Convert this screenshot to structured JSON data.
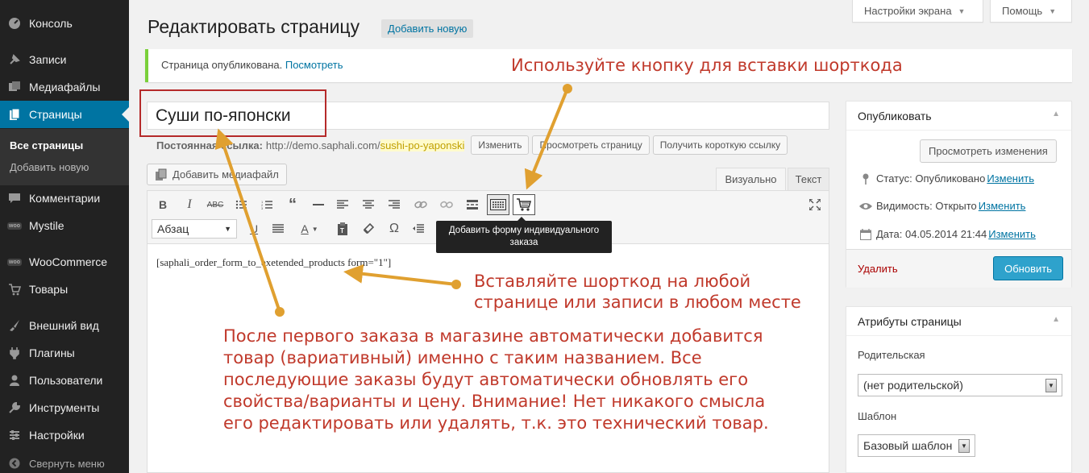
{
  "sidebar": {
    "items": [
      {
        "label": "Консоль",
        "icon": "dashboard-icon"
      },
      {
        "label": "Записи",
        "icon": "pin-icon"
      },
      {
        "label": "Медиафайлы",
        "icon": "media-icon"
      },
      {
        "label": "Страницы",
        "icon": "pages-icon"
      },
      {
        "label": "Комментарии",
        "icon": "comments-icon"
      },
      {
        "label": "Mystile",
        "icon": "woo-icon"
      },
      {
        "label": "WooCommerce",
        "icon": "woo-icon"
      },
      {
        "label": "Товары",
        "icon": "cart-icon"
      },
      {
        "label": "Внешний вид",
        "icon": "brush-icon"
      },
      {
        "label": "Плагины",
        "icon": "plugin-icon"
      },
      {
        "label": "Пользователи",
        "icon": "users-icon"
      },
      {
        "label": "Инструменты",
        "icon": "tools-icon"
      },
      {
        "label": "Настройки",
        "icon": "settings-icon"
      },
      {
        "label": "Свернуть меню",
        "icon": "collapse-icon"
      }
    ],
    "submenu": [
      "Все страницы",
      "Добавить новую"
    ],
    "woo_badge": "woo"
  },
  "screen_meta": {
    "options": "Настройки экрана",
    "help": "Помощь"
  },
  "header": {
    "title": "Редактировать страницу",
    "add_new": "Добавить новую"
  },
  "notice": {
    "text": "Страница опубликована.",
    "link": "Посмотреть"
  },
  "editor": {
    "post_title": "Суши по-японски",
    "permalink_label": "Постоянная ссылка:",
    "permalink_base": "http://demo.saphali.com/",
    "permalink_slug": "sushi-po-yaponski",
    "edit_button": "Изменить",
    "view_page_button": "Просмотреть страницу",
    "shortlink_button": "Получить короткую ссылку",
    "add_media": "Добавить медиафайл",
    "tab_visual": "Визуально",
    "tab_text": "Текст",
    "format_select": "Абзац",
    "tooltip": "Добавить форму индивидуального заказа",
    "content": "[saphali_order_form_to_exetended_products form=\"1\"]"
  },
  "publish_box": {
    "title": "Опубликовать",
    "preview_button": "Просмотреть изменения",
    "status_label": "Статус:",
    "status_value": "Опубликовано",
    "visibility_label": "Видимость:",
    "visibility_value": "Открыто",
    "date_label": "Дата:",
    "date_value": "04.05.2014 21:44",
    "edit_link": "Изменить",
    "delete": "Удалить",
    "update": "Обновить"
  },
  "attributes_box": {
    "title": "Атрибуты страницы",
    "parent_label": "Родительская",
    "parent_value": "(нет родительской)",
    "template_label": "Шаблон",
    "template_value": "Базовый шаблон"
  },
  "annotations": {
    "button_hint": "Используйте кнопку для вставки шорткода",
    "shortcode_hint_1": "Вставляйте шорткод на любой",
    "shortcode_hint_2": "странице или записи в любом месте",
    "title_hint_1": "После первого заказа в магазине автоматически добавится",
    "title_hint_2": "товар (вариативный) именно с таким названием. Все",
    "title_hint_3": "последующие заказы будут автоматически обновлять его",
    "title_hint_4": "свойства/варианты и цену. Внимание! Нет никакого смысла",
    "title_hint_5": "его редактировать или удалять, т.к. это технический товар.",
    "color": "#c0392b",
    "arrow_color": "#e0a030"
  }
}
